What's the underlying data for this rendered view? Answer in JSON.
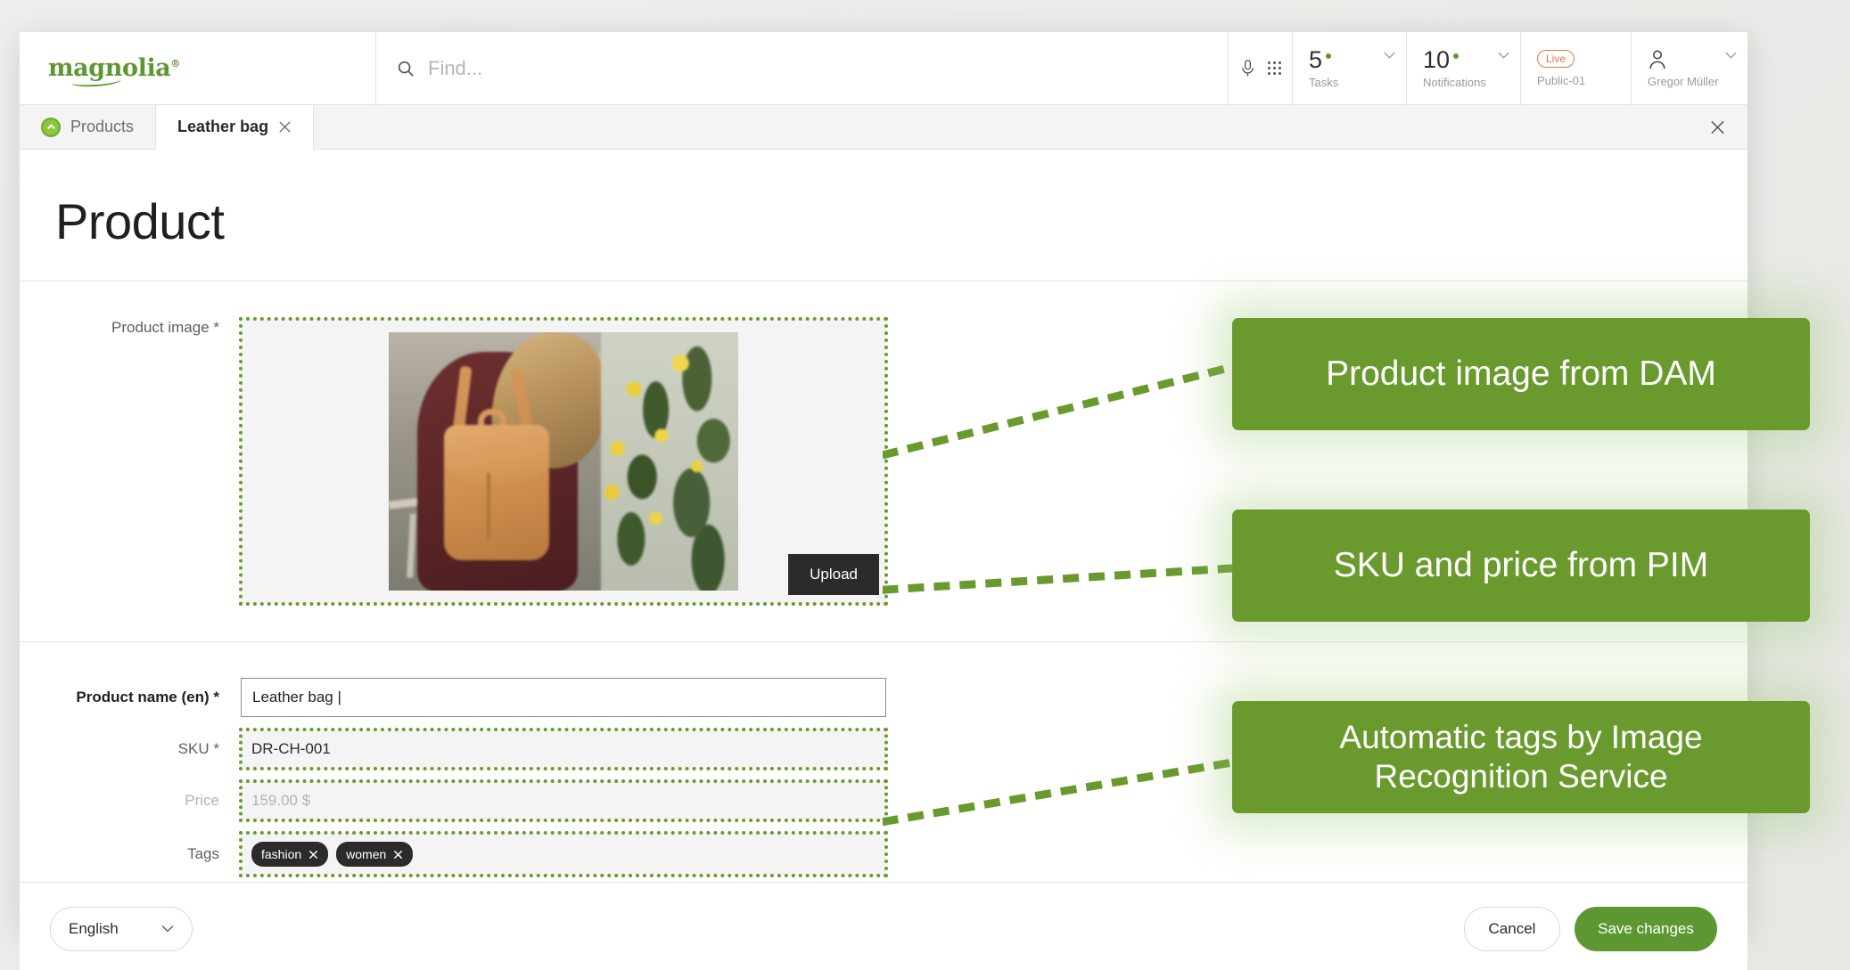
{
  "topbar": {
    "logo_text": "magnolia",
    "logo_reg": "®",
    "search_placeholder": "Find...",
    "mic_icon": "microphone-icon",
    "apps_icon": "apps-grid-icon",
    "search_icon": "search-icon",
    "tasks": {
      "count": "5",
      "label": "Tasks"
    },
    "notifications": {
      "count": "10",
      "label": "Notifications"
    },
    "environment": {
      "badge": "Live",
      "label": "Public-01"
    },
    "user": {
      "name": "Gregor Müller"
    }
  },
  "tabs": [
    {
      "label": "Products",
      "active": false,
      "icon": "magnolia-app-icon"
    },
    {
      "label": "Leather bag",
      "active": true,
      "icon": "close-icon"
    }
  ],
  "page": {
    "title": "Product"
  },
  "form": {
    "image_label": "Product image *",
    "upload_label": "Upload",
    "name_label": "Product name (en) *",
    "name_value": "Leather bag |",
    "sku_label": "SKU *",
    "sku_value": "DR-CH-001",
    "price_label": "Price",
    "price_value": "159.00  $",
    "tags_label": "Tags",
    "tags": [
      "fashion",
      "women"
    ]
  },
  "footer": {
    "language": "English",
    "cancel_label": "Cancel",
    "save_label": "Save changes"
  },
  "callouts": [
    {
      "text": "Product image from DAM"
    },
    {
      "text": "SKU and price from PIM"
    },
    {
      "text": "Automatic tags by Image Recognition Service"
    }
  ],
  "colors": {
    "brand_green": "#5d9732",
    "callout_green": "#6a9a2e",
    "live_orange": "#e8734a",
    "tag_dark": "#2b2b2b"
  }
}
